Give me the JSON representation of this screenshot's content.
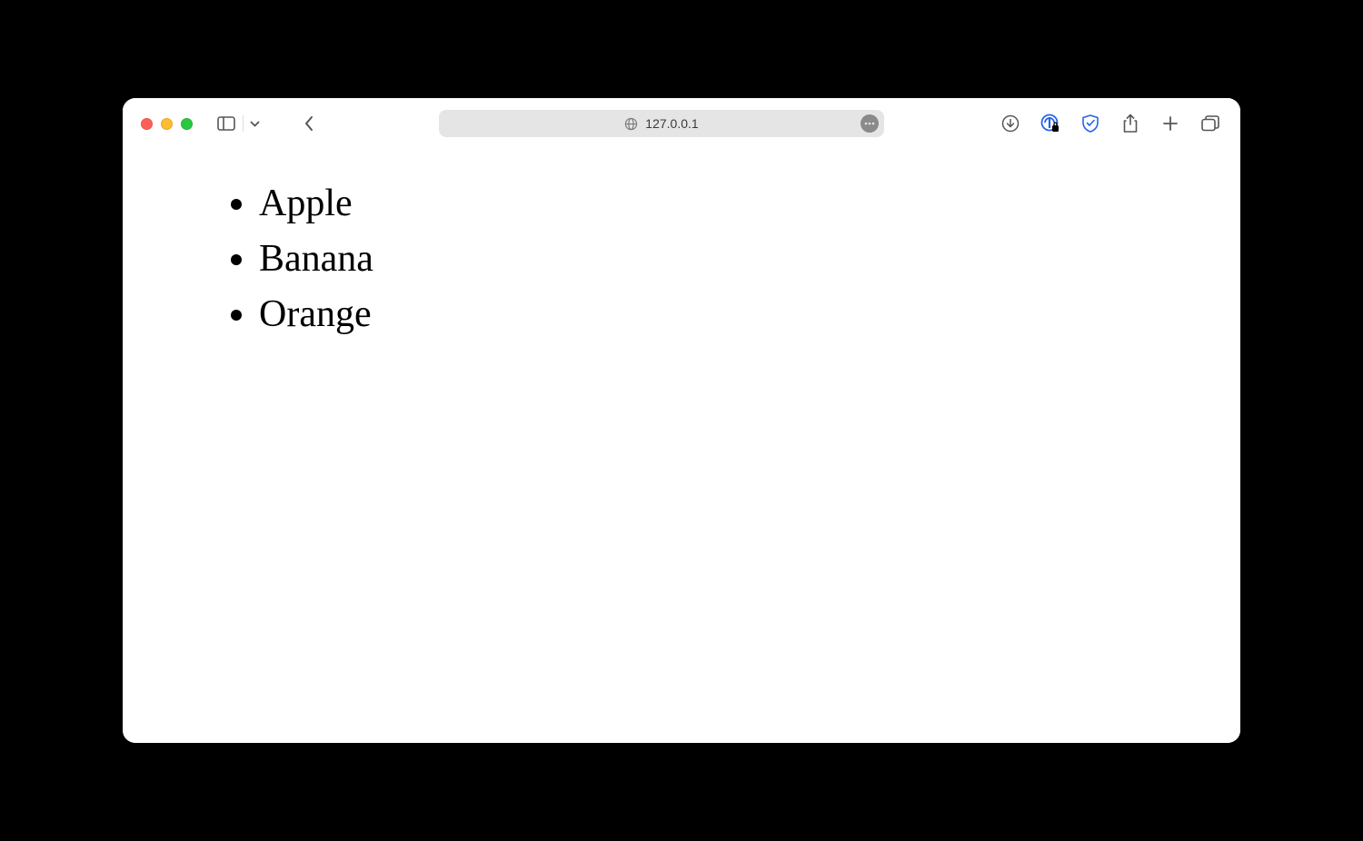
{
  "browser": {
    "address": "127.0.0.1"
  },
  "page": {
    "items": [
      "Apple",
      "Banana",
      "Orange"
    ]
  }
}
